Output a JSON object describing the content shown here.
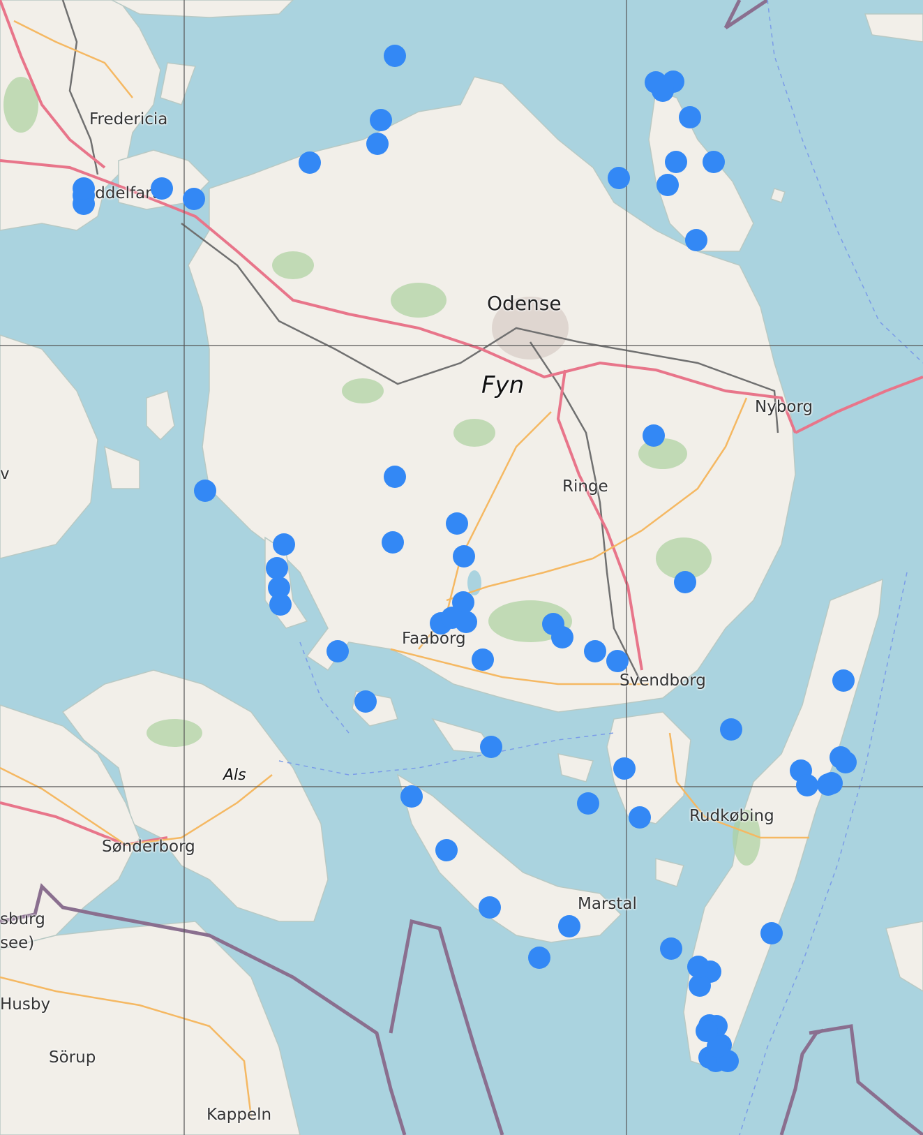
{
  "map": {
    "colors": {
      "water": "#aad3df",
      "land": "#f2efe9",
      "motorway": "#e8758a",
      "primary_road": "#f5b862",
      "railway": "#707070",
      "border": "#8a6f8f",
      "grid": "#555555",
      "marker": "#3388f5"
    },
    "labels": [
      {
        "name": "fredericia",
        "text": "Fredericia",
        "kind": "town"
      },
      {
        "name": "middelfart",
        "text": "Middelfart",
        "kind": "town"
      },
      {
        "name": "odense",
        "text": "Odense",
        "kind": "city"
      },
      {
        "name": "fyn",
        "text": "Fyn",
        "kind": "island"
      },
      {
        "name": "nyborg",
        "text": "Nyborg",
        "kind": "town"
      },
      {
        "name": "ringe",
        "text": "Ringe",
        "kind": "town"
      },
      {
        "name": "faaborg",
        "text": "Faaborg",
        "kind": "town"
      },
      {
        "name": "svendborg",
        "text": "Svendborg",
        "kind": "town"
      },
      {
        "name": "als",
        "text": "Als",
        "kind": "island-small"
      },
      {
        "name": "sonderborg",
        "text": "Sønderborg",
        "kind": "town"
      },
      {
        "name": "rudkobing",
        "text": "Rudkøbing",
        "kind": "town"
      },
      {
        "name": "marstal",
        "text": "Marstal",
        "kind": "town"
      },
      {
        "name": "flensburg-fragment",
        "text": "sburg",
        "kind": "town"
      },
      {
        "name": "flensburg-see-fragment",
        "text": "see)",
        "kind": "town"
      },
      {
        "name": "husby",
        "text": "Husby",
        "kind": "town"
      },
      {
        "name": "sorup",
        "text": "Sörup",
        "kind": "town"
      },
      {
        "name": "kappeln",
        "text": "Kappeln",
        "kind": "town"
      },
      {
        "name": "west-edge-fragment",
        "text": "v",
        "kind": "town"
      }
    ],
    "marker_count": 70
  }
}
